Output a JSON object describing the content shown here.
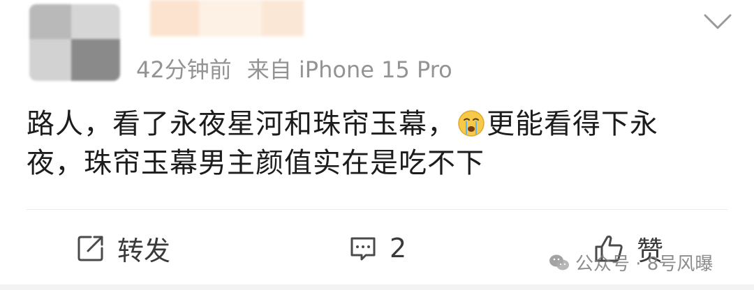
{
  "post": {
    "time": "42分钟前",
    "source": "来自 iPhone 15 Pro",
    "text_line1_a": "路人，看了永夜星河和珠帘玉幕，",
    "text_line1_b": "更能看得下永",
    "text_line2": "夜，珠帘玉幕男主颜值实在是吃不下",
    "emoji_icon": "crying-face-icon"
  },
  "actions": {
    "repost_label": "转发",
    "comment_count": "2",
    "like_label": "赞"
  },
  "watermark": {
    "text": "公众号 · 8号风曝"
  },
  "colors": {
    "meta_gray": "#939393",
    "text_dark": "#1c1c1c"
  }
}
